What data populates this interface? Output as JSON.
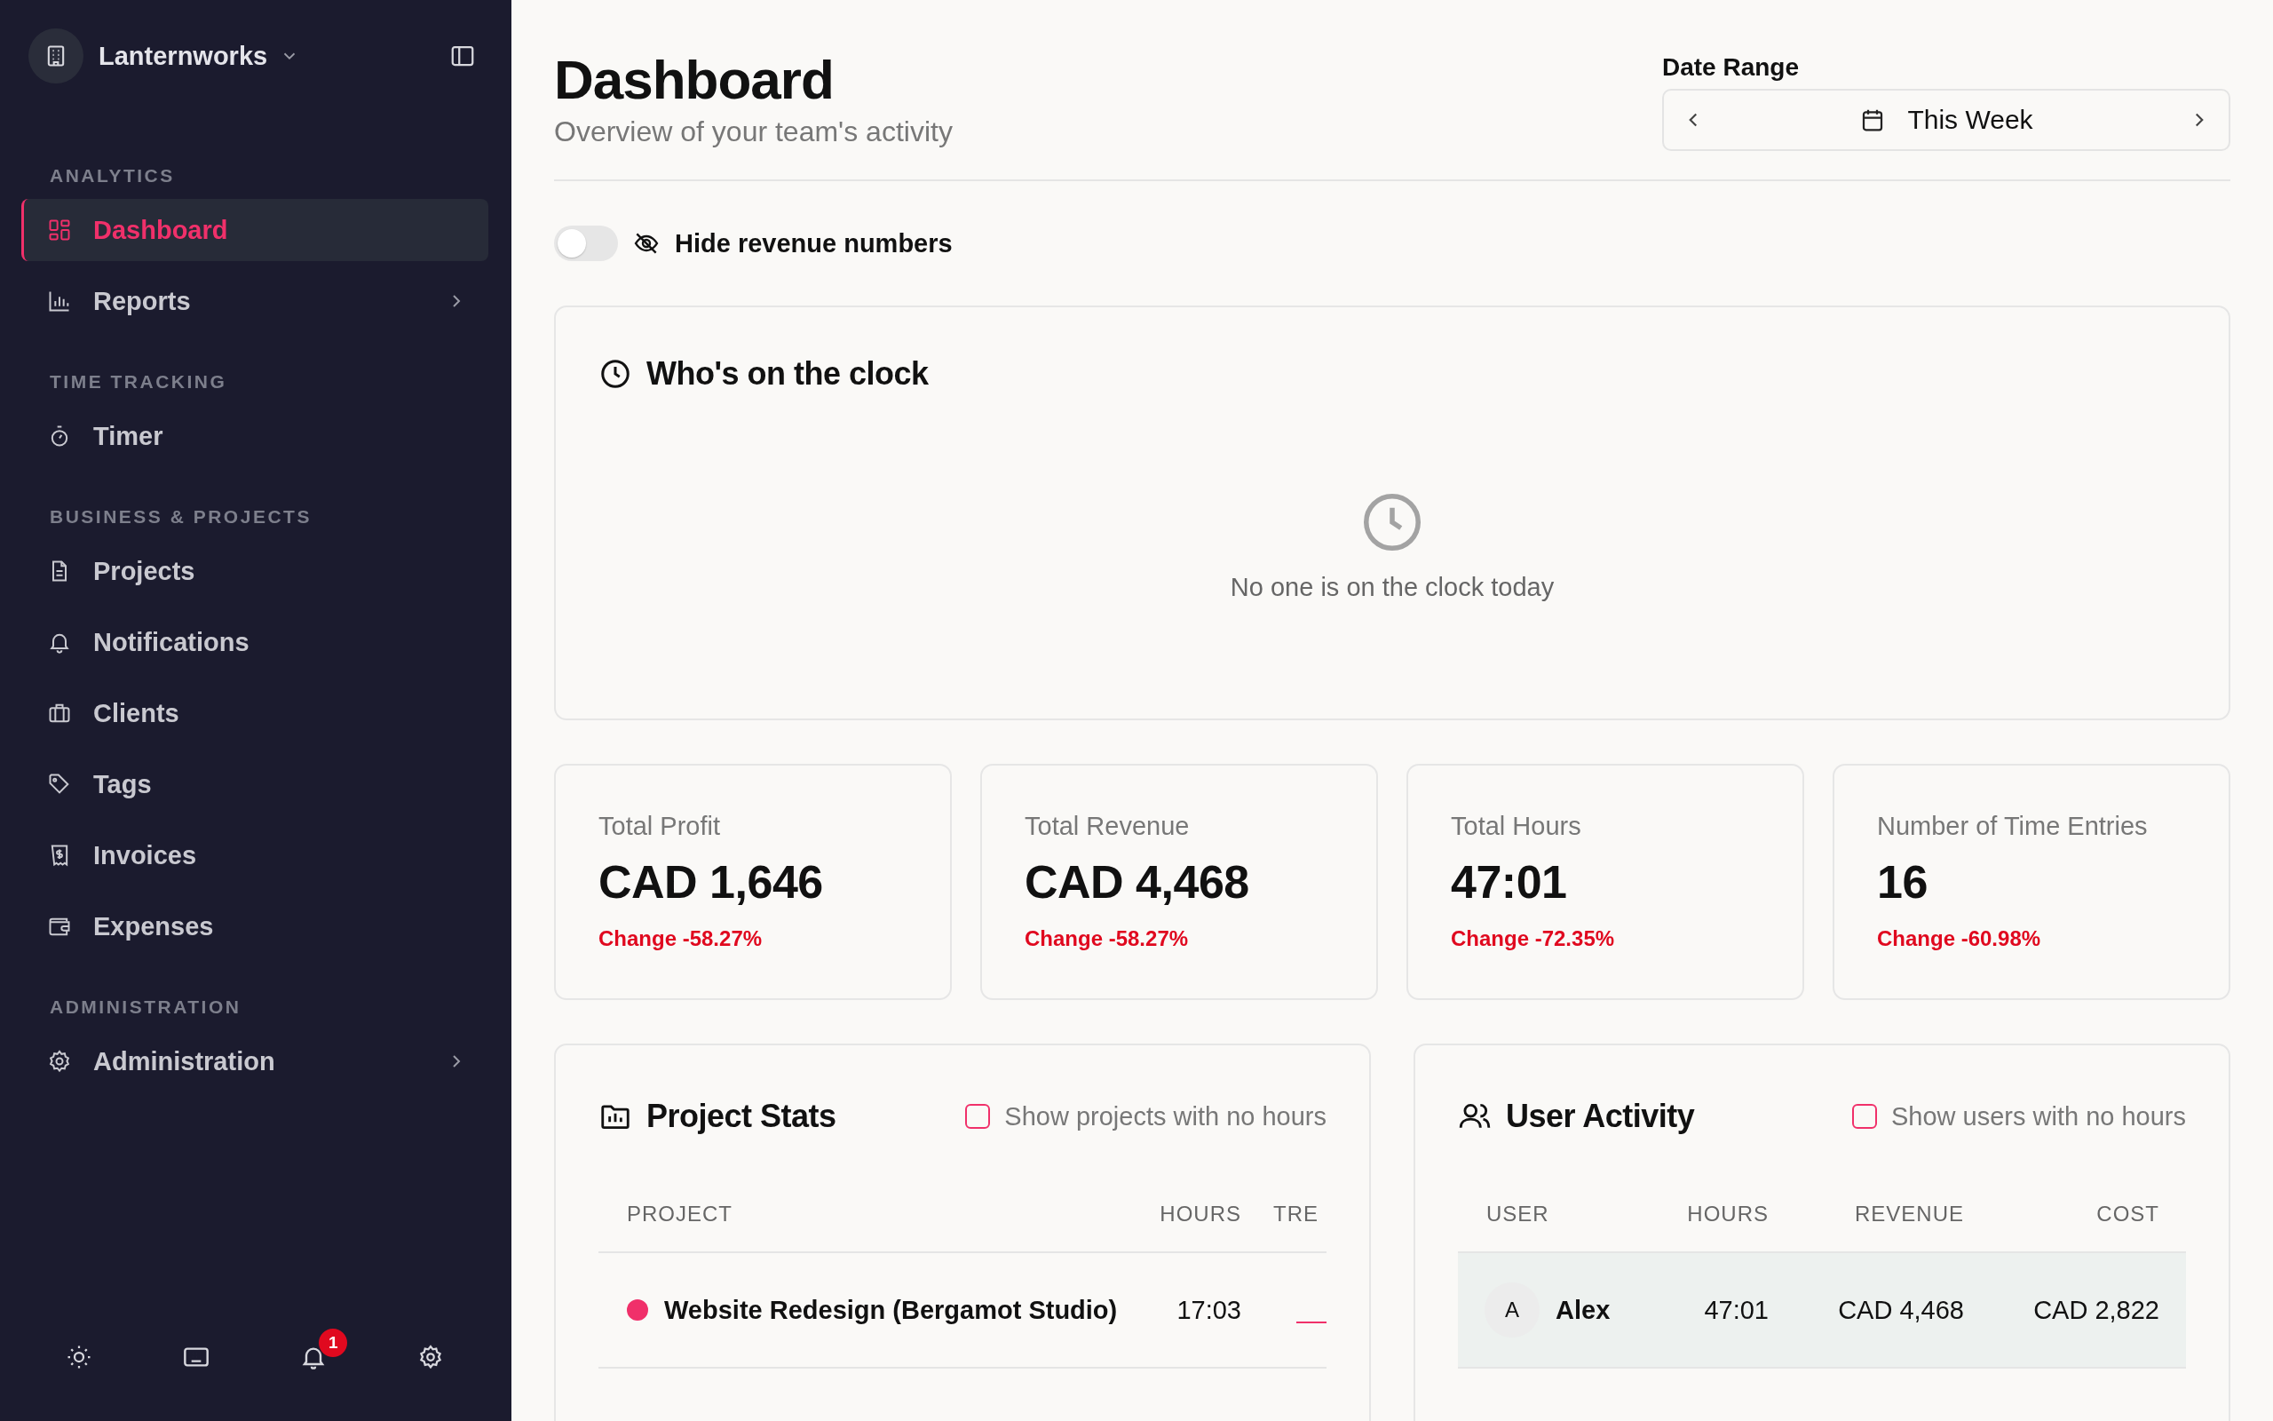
{
  "sidebar": {
    "workspace": {
      "name": "Lanternworks"
    },
    "sections": [
      {
        "title": "ANALYTICS",
        "items": [
          {
            "label": "Dashboard",
            "selected": true
          },
          {
            "label": "Reports",
            "selected": false,
            "expanded": false
          }
        ]
      },
      {
        "title": "TIME TRACKING",
        "items": [
          {
            "label": "Timer",
            "selected": false
          }
        ]
      },
      {
        "title": "BUSINESS & PROJECTS",
        "items": [
          {
            "label": "Projects",
            "selected": false
          },
          {
            "label": "Notifications",
            "selected": false
          },
          {
            "label": "Clients",
            "selected": false
          },
          {
            "label": "Tags",
            "selected": false
          },
          {
            "label": "Invoices",
            "selected": false
          },
          {
            "label": "Expenses",
            "selected": false
          }
        ]
      },
      {
        "title": "ADMINISTRATION",
        "items": [
          {
            "label": "Administration",
            "selected": false,
            "expanded": false
          }
        ]
      }
    ],
    "footer": {
      "notification_count": "1"
    }
  },
  "header": {
    "title": "Dashboard",
    "subtitle": "Overview of your team's activity",
    "date_range": {
      "label": "Date Range",
      "value": "This Week"
    }
  },
  "hide_revenue": {
    "label": "Hide revenue numbers",
    "on": false
  },
  "clock_card": {
    "title": "Who's on the clock",
    "empty_text": "No one is on the clock today"
  },
  "stats": [
    {
      "label": "Total Profit",
      "value": "CAD 1,646",
      "change": "Change -58.27%"
    },
    {
      "label": "Total Revenue",
      "value": "CAD 4,468",
      "change": "Change -58.27%"
    },
    {
      "label": "Total Hours",
      "value": "47:01",
      "change": "Change -72.35%"
    },
    {
      "label": "Number of Time Entries",
      "value": "16",
      "change": "Change -60.98%"
    }
  ],
  "project_stats": {
    "title": "Project Stats",
    "filter": {
      "label": "Show projects with no hours",
      "checked": false
    },
    "columns": [
      "PROJECT",
      "HOURS",
      "TRE"
    ],
    "rows": [
      {
        "project": "Website Redesign (Bergamot Studio)",
        "color": "#f0306a",
        "hours": "17:03"
      }
    ]
  },
  "user_activity": {
    "title": "User Activity",
    "filter": {
      "label": "Show users with no hours",
      "checked": false
    },
    "columns": [
      "USER",
      "HOURS",
      "REVENUE",
      "COST"
    ],
    "rows": [
      {
        "initial": "A",
        "user": "Alex",
        "hours": "47:01",
        "revenue": "CAD 4,468",
        "cost": "CAD 2,822",
        "selected": true
      }
    ]
  }
}
